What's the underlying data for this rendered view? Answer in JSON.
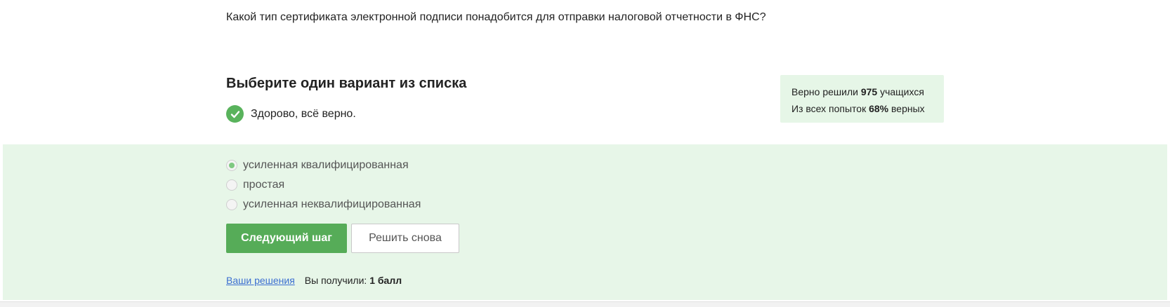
{
  "question": {
    "text": "Какой тип сертификата электронной подписи понадобится для отправки налоговой отчетности в ФНС?"
  },
  "task": {
    "heading": "Выберите один вариант из списка",
    "result_text": "Здорово, всё верно.",
    "result_icon": "check-circle-icon",
    "result_color": "#59b35c"
  },
  "stats": {
    "solved_prefix": "Верно решили",
    "solved_count": "975",
    "solved_suffix": "учащихся",
    "attempts_prefix": "Из всех попыток",
    "attempts_percent": "68%",
    "attempts_suffix": "верных"
  },
  "options": [
    {
      "label": "усиленная квалифицированная",
      "selected": true
    },
    {
      "label": "простая",
      "selected": false
    },
    {
      "label": "усиленная неквалифицированная",
      "selected": false
    }
  ],
  "buttons": {
    "next_label": "Следующий шаг",
    "retry_label": "Решить снова"
  },
  "footer": {
    "solutions_link": "Ваши решения",
    "received_label": "Вы получили:",
    "score": "1 балл"
  },
  "colors": {
    "accent_green": "#56ac58",
    "panel_green": "#e7f6e8",
    "link_blue": "#3c6fd1"
  }
}
